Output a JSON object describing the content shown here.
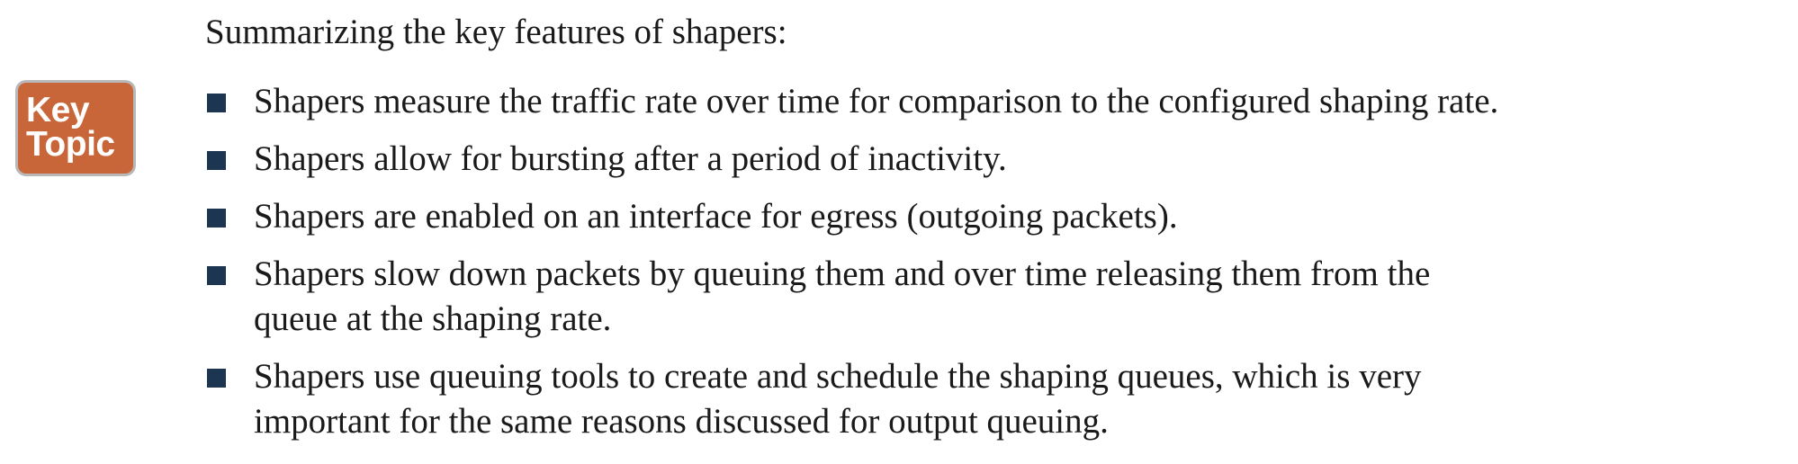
{
  "badge": {
    "line1": "Key",
    "line2": "Topic"
  },
  "intro": "Summarizing the key features of shapers:",
  "bullets": [
    {
      "lines": [
        "Shapers measure the traffic rate over time for comparison to the configured shaping rate."
      ]
    },
    {
      "lines": [
        "Shapers allow for bursting after a period of inactivity."
      ]
    },
    {
      "lines": [
        "Shapers are enabled on an interface for egress (outgoing packets)."
      ]
    },
    {
      "lines": [
        "Shapers slow down packets by queuing them and over time releasing them from the",
        "queue at the shaping rate."
      ]
    },
    {
      "lines": [
        "Shapers use queuing tools to create and schedule the shaping queues, which is very",
        "important for the same reasons discussed for output queuing."
      ]
    }
  ]
}
